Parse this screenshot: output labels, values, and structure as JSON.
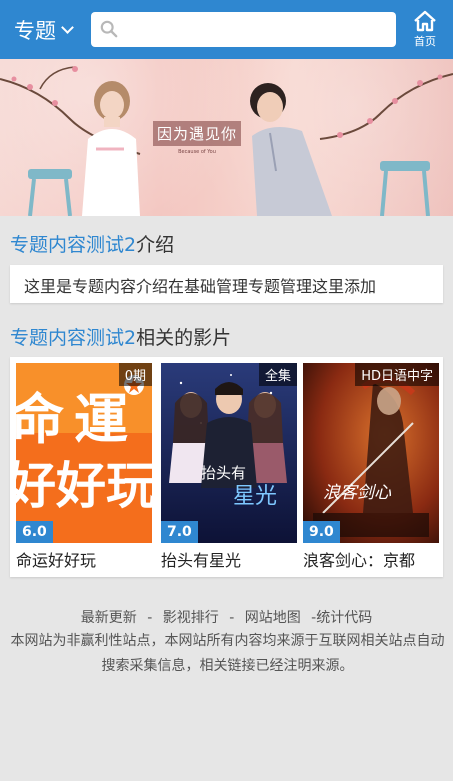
{
  "header": {
    "brand_label": "专题",
    "search_placeholder": "",
    "home_label": "首页"
  },
  "banner": {
    "title": "因为遇见你",
    "subtitle": "Because of You"
  },
  "intro": {
    "heading_highlight": "专题内容测试2",
    "heading_suffix": "介绍",
    "text": "这里是专题内容介绍在基础管理专题管理这里添加"
  },
  "related": {
    "heading_highlight": "专题内容测试2",
    "heading_suffix": "相关的影片",
    "movies": [
      {
        "title": "命运好好玩",
        "badge": "0期",
        "score": "6.0"
      },
      {
        "title": "抬头有星光",
        "badge": "全集",
        "score": "7.0"
      },
      {
        "title": "浪客剑心：京都",
        "badge": "HD日语中字",
        "score": "9.0"
      }
    ]
  },
  "footer": {
    "links": [
      "最新更新",
      "影视排行",
      "网站地图",
      "统计代码"
    ],
    "separator": "-",
    "note": "本网站为非赢利性站点，本网站所有内容均来源于互联网相关站点自动搜索采集信息，相关链接已经注明来源。"
  },
  "colors": {
    "header": "#2f87d0",
    "accent": "#2f87d0",
    "background": "#e6e6e6"
  }
}
